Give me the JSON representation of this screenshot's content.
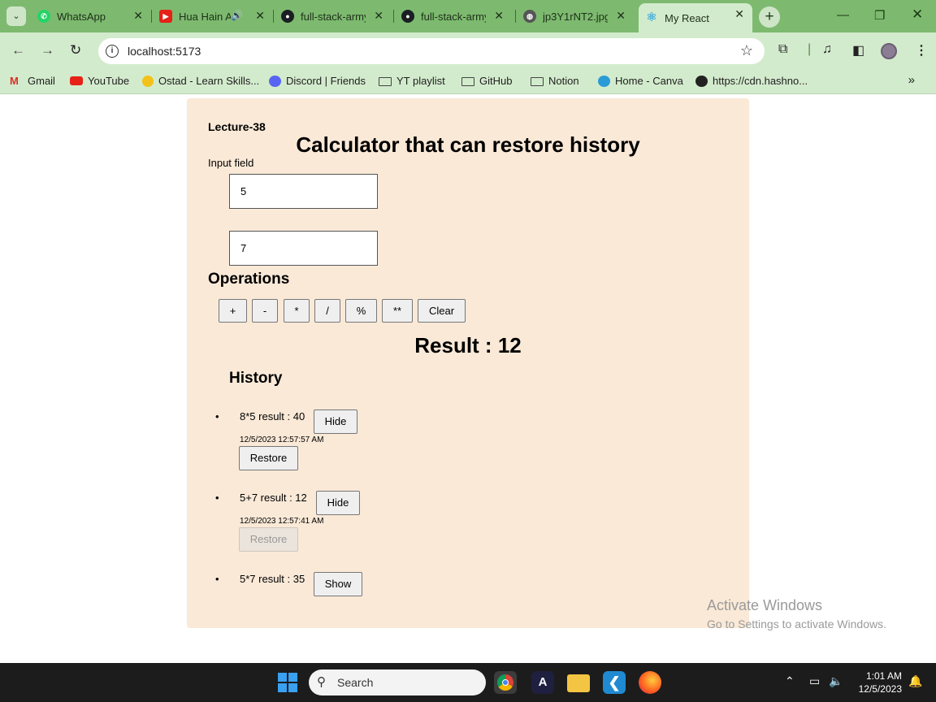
{
  "browser": {
    "tabs": [
      {
        "title": "WhatsApp",
        "icon": "whatsapp-icon",
        "color": "#25d366"
      },
      {
        "title": "Hua Hain Aaj",
        "icon": "youtube-icon",
        "color": "#e62117"
      },
      {
        "title": "full-stack-army",
        "icon": "github-icon",
        "color": "#1b1f23"
      },
      {
        "title": "full-stack-army",
        "icon": "github-icon",
        "color": "#1b1f23"
      },
      {
        "title": "jp3Y1rNT2.jpg",
        "icon": "globe-icon",
        "color": "#555555"
      },
      {
        "title": "My React",
        "icon": "react-icon",
        "color": "#4fb3d9"
      }
    ],
    "url": "localhost:5173",
    "bookmarks": [
      {
        "label": "Gmail",
        "icon": "gmail-icon"
      },
      {
        "label": "YouTube",
        "icon": "youtube-icon"
      },
      {
        "label": "Ostad - Learn Skills...",
        "icon": "ostad-icon"
      },
      {
        "label": "Discord | Friends",
        "icon": "discord-icon"
      },
      {
        "label": "YT playlist",
        "icon": "folder-icon"
      },
      {
        "label": "GitHub",
        "icon": "folder-icon"
      },
      {
        "label": "Notion",
        "icon": "folder-icon"
      },
      {
        "label": "Home - Canva",
        "icon": "canva-icon"
      },
      {
        "label": "https://cdn.hashno...",
        "icon": "globe-icon"
      }
    ]
  },
  "app": {
    "lecture": "Lecture-38",
    "title": "Calculator that can restore history",
    "input_label": "Input field",
    "input_a": "5",
    "input_b": "7",
    "operations_heading": "Operations",
    "ops": [
      "+",
      "-",
      "*",
      "/",
      "%",
      "**",
      "Clear"
    ],
    "result": "Result : 12",
    "history_heading": "History",
    "history": [
      {
        "text": "8*5 result : 40",
        "toggle": "Hide",
        "date": "12/5/2023 12:57:57 AM",
        "restore": "Restore",
        "restore_disabled": false
      },
      {
        "text": "5+7 result : 12",
        "toggle": "Hide",
        "date": "12/5/2023 12:57:41 AM",
        "restore": "Restore",
        "restore_disabled": true
      },
      {
        "text": "5*7 result : 35",
        "toggle": "Show"
      }
    ]
  },
  "watermark": {
    "line1": "Activate Windows",
    "line2": "Go to Settings to activate Windows."
  },
  "taskbar": {
    "search": "Search",
    "time": "1:01 AM",
    "date": "12/5/2023",
    "apps": [
      "chrome-icon",
      "affinity-icon",
      "file-explorer-icon",
      "vscode-icon",
      "firefox-icon"
    ]
  }
}
